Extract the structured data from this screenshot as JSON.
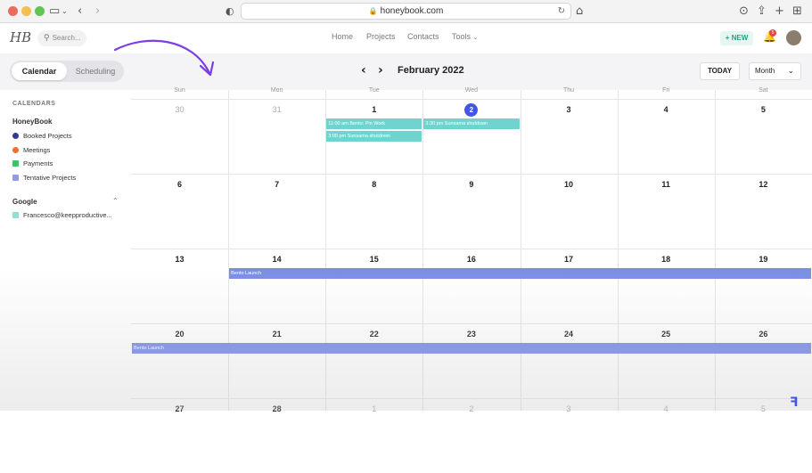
{
  "browser": {
    "url": "honeybook.com",
    "traffic_colors": [
      "#ed6a5e",
      "#f5bf4f",
      "#61c554"
    ]
  },
  "nav": {
    "logo": "HB",
    "search_placeholder": "Search...",
    "links": [
      "Home",
      "Projects",
      "Contacts",
      "Tools"
    ],
    "new_label": "+ NEW",
    "notification_count": "5"
  },
  "toolbar": {
    "tabs": [
      "Calendar",
      "Scheduling"
    ],
    "active_tab": "Calendar",
    "month_title": "February 2022",
    "today_label": "TODAY",
    "view_label": "Month"
  },
  "sidebar": {
    "heading": "CALENDARS",
    "honeybook_group": "HoneyBook",
    "honeybook_items": [
      {
        "label": "Booked Projects",
        "color": "#2e3a9c"
      },
      {
        "label": "Meetings",
        "color": "#f0702b"
      },
      {
        "label": "Payments",
        "color": "#3cc46b"
      },
      {
        "label": "Tentative Projects",
        "color": "#8f9be8"
      }
    ],
    "google_group": "Google",
    "google_items": [
      {
        "label": "Francesco@keepproductive...",
        "color": "#8fdfdb"
      }
    ]
  },
  "calendar": {
    "weekdays": [
      "Sun",
      "Mon",
      "Tue",
      "Wed",
      "Thu",
      "Fri",
      "Sat"
    ],
    "weeks": [
      [
        {
          "d": "30",
          "muted": true
        },
        {
          "d": "31",
          "muted": true
        },
        {
          "d": "1"
        },
        {
          "d": "2",
          "today": true
        },
        {
          "d": "3"
        },
        {
          "d": "4"
        },
        {
          "d": "5"
        }
      ],
      [
        {
          "d": "6"
        },
        {
          "d": "7"
        },
        {
          "d": "8"
        },
        {
          "d": "9"
        },
        {
          "d": "10"
        },
        {
          "d": "11"
        },
        {
          "d": "12"
        }
      ],
      [
        {
          "d": "13"
        },
        {
          "d": "14"
        },
        {
          "d": "15"
        },
        {
          "d": "16"
        },
        {
          "d": "17"
        },
        {
          "d": "18"
        },
        {
          "d": "19"
        }
      ],
      [
        {
          "d": "20"
        },
        {
          "d": "21"
        },
        {
          "d": "22"
        },
        {
          "d": "23"
        },
        {
          "d": "24"
        },
        {
          "d": "25"
        },
        {
          "d": "26"
        }
      ],
      [
        {
          "d": "27"
        },
        {
          "d": "28"
        },
        {
          "d": "1",
          "muted": true
        },
        {
          "d": "2",
          "muted": true
        },
        {
          "d": "3",
          "muted": true
        },
        {
          "d": "4",
          "muted": true
        },
        {
          "d": "5",
          "muted": true
        }
      ]
    ],
    "events": [
      {
        "label": "11:00 am Bento: Pin Work",
        "week": 0,
        "day": 2,
        "span": 1,
        "slot": 0,
        "color": "teal"
      },
      {
        "label": "3:00 pm Sunsama shutdown",
        "week": 0,
        "day": 2,
        "span": 1,
        "slot": 1,
        "color": "teal"
      },
      {
        "label": "3:30 pm Sunsama shutdown",
        "week": 0,
        "day": 3,
        "span": 1,
        "slot": 0,
        "color": "teal"
      },
      {
        "label": "Bento Launch",
        "week": 2,
        "day": 1,
        "span": 6,
        "slot": 0,
        "color": "blue"
      },
      {
        "label": "Bento Launch",
        "week": 3,
        "day": 0,
        "span": 7,
        "slot": 0,
        "color": "blue"
      }
    ]
  }
}
